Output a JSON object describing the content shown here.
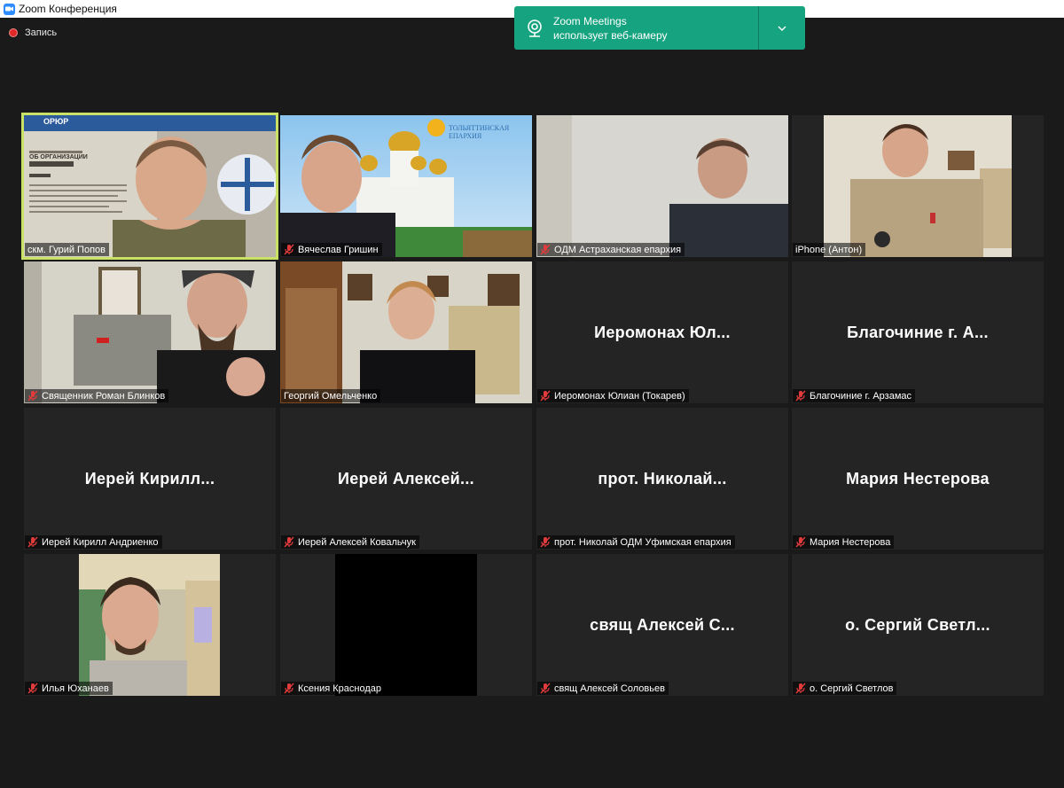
{
  "window": {
    "title": "Zoom Конференция",
    "recording_label": "Запись"
  },
  "notification": {
    "app": "Zoom Meetings",
    "message": "использует веб-камеру",
    "icon": "webcam-icon",
    "color": "#16a37f"
  },
  "accent_active": "#c9e265",
  "participants": [
    {
      "name": "скм. Гурий Попов",
      "muted": false,
      "video": true,
      "active": true,
      "screen": {
        "brand": "ОРЮР",
        "heading": "ОБ ОРГАНИЗАЦИИ"
      }
    },
    {
      "name": "Вячеслав Гришин",
      "muted": true,
      "video": true,
      "screen": {
        "brand": "ТОЛЬЯТТИНСКАЯ ЕПАРХИЯ"
      }
    },
    {
      "name": "ОДМ Астраханская епархия",
      "muted": true,
      "video": true
    },
    {
      "name": "iPhone (Антон)",
      "muted": false,
      "video": true
    },
    {
      "name": "Священник Роман Блинков",
      "muted": true,
      "video": true
    },
    {
      "name": "Георгий Омельченко",
      "muted": false,
      "video": true
    },
    {
      "name": "Иеромонах Юлиан (Токарев)",
      "muted": true,
      "video": false,
      "display": "Иеромонах  Юл..."
    },
    {
      "name": "Благочиние г. Арзамас",
      "muted": true,
      "video": false,
      "display": "Благочиние  г.  А..."
    },
    {
      "name": "Иерей Кирилл Андриенко",
      "muted": true,
      "video": false,
      "display": "Иерей  Кирилл..."
    },
    {
      "name": "Иерей Алексей Ковальчук",
      "muted": true,
      "video": false,
      "display": "Иерей  Алексей..."
    },
    {
      "name": "прот. Николай ОДМ Уфимская епархия",
      "muted": true,
      "video": false,
      "display": "прот.  Николай..."
    },
    {
      "name": "Мария Нестерова",
      "muted": true,
      "video": false,
      "display": "Мария  Нестерова"
    },
    {
      "name": "Илья Юханаев",
      "muted": true,
      "video": true
    },
    {
      "name": "Ксения Краснодар",
      "muted": true,
      "video": true
    },
    {
      "name": "свящ Алексей Соловьев",
      "muted": true,
      "video": false,
      "display": "свящ  Алексей  С..."
    },
    {
      "name": "о. Сергий Светлов",
      "muted": true,
      "video": false,
      "display": "о.  Сергий  Светл..."
    }
  ]
}
